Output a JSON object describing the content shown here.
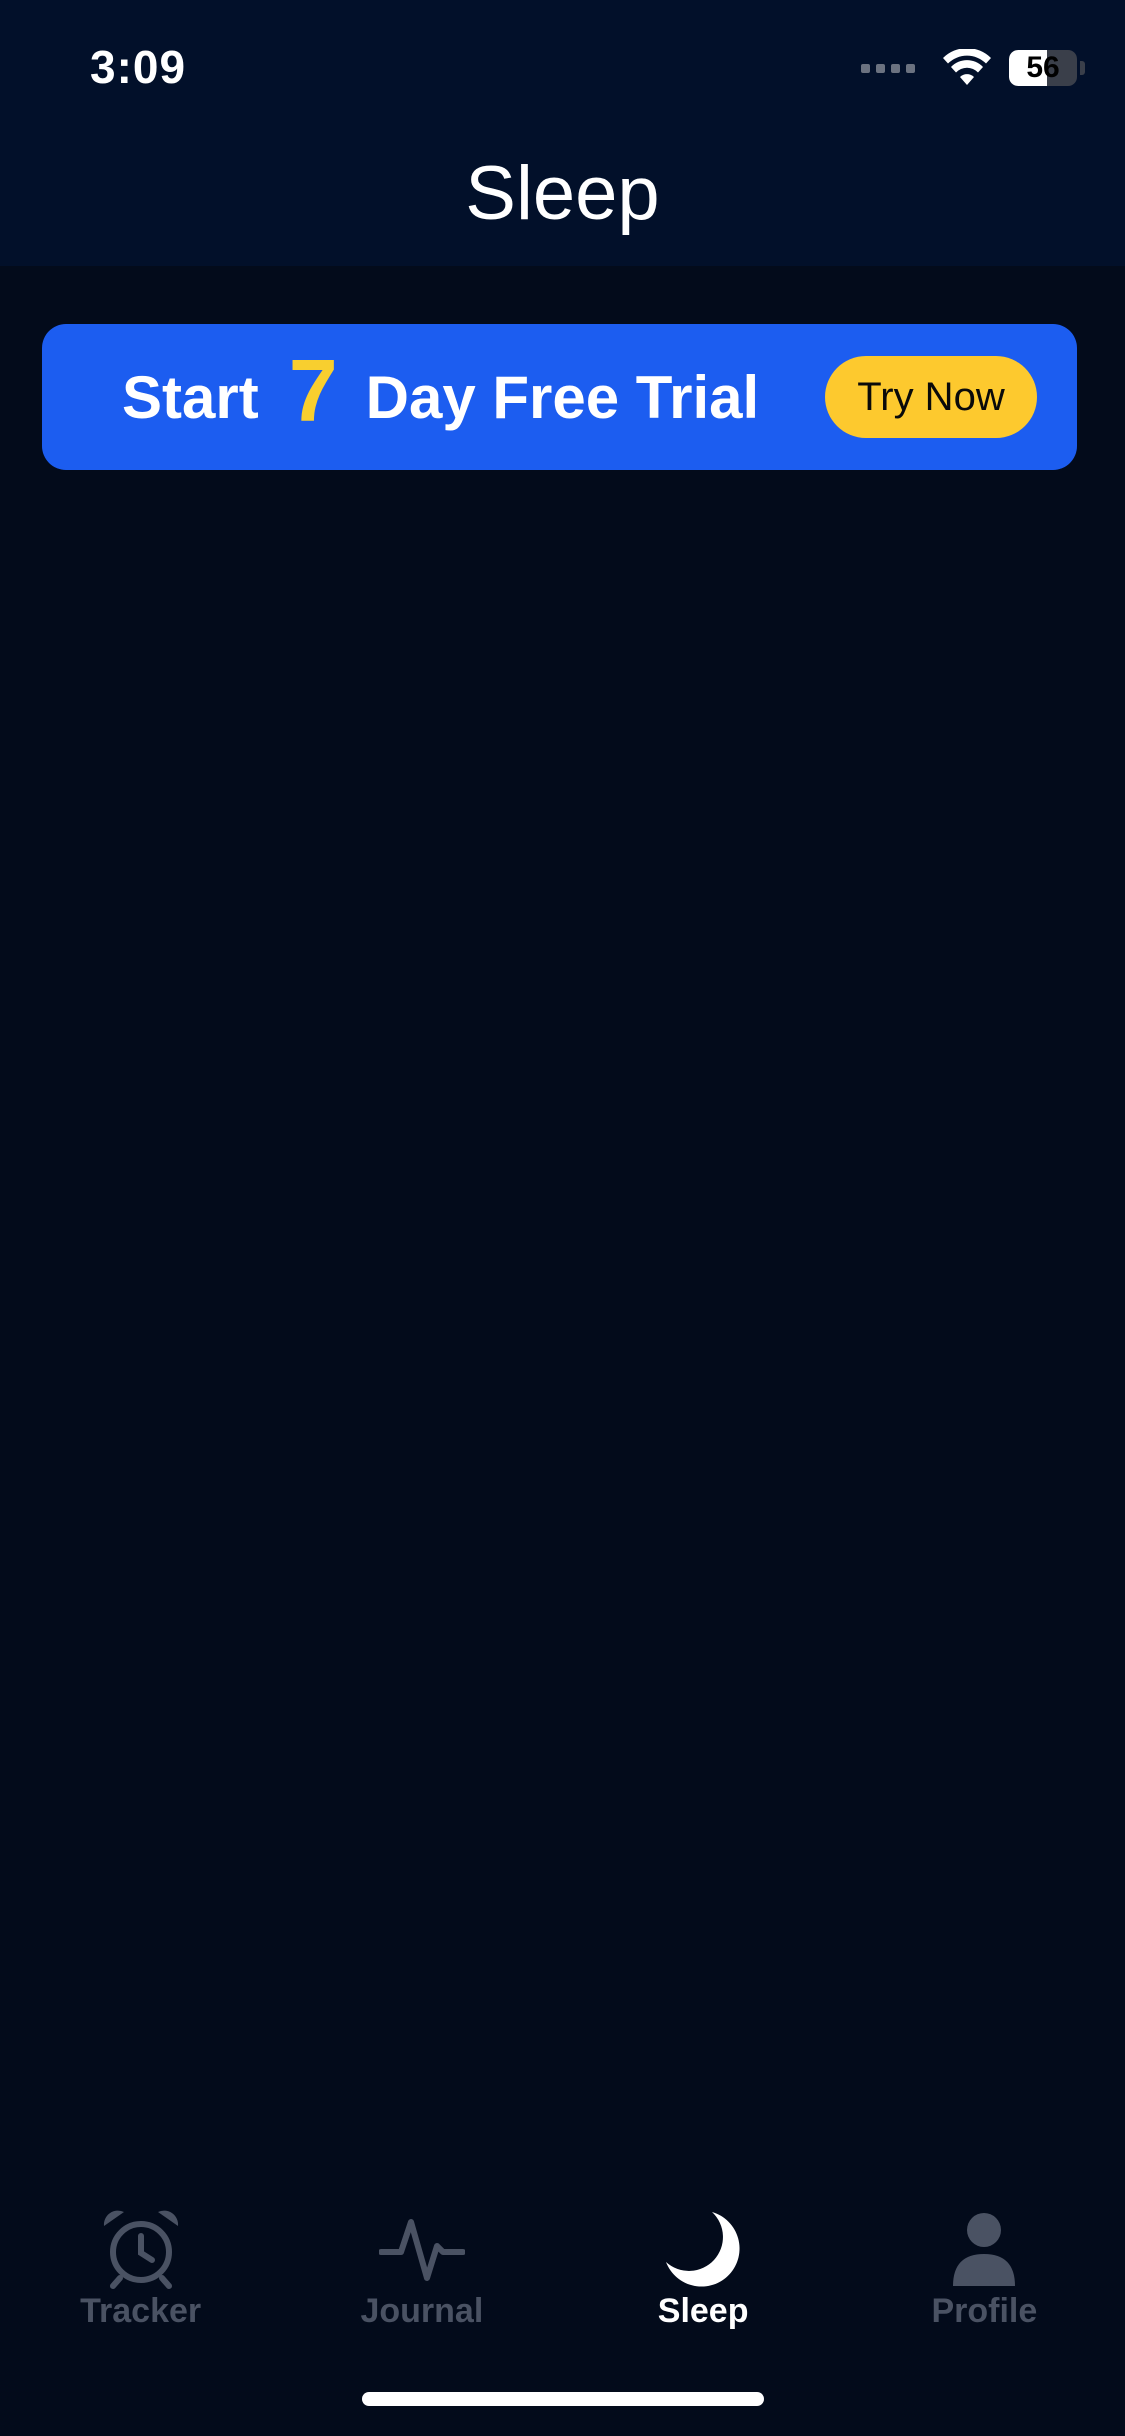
{
  "status_bar": {
    "time": "3:09",
    "battery_level": "56",
    "battery_percent": 56
  },
  "header": {
    "title": "Sleep"
  },
  "promo": {
    "prefix": "Start",
    "number": "7",
    "suffix": "Day Free Trial",
    "button_label": "Try Now",
    "banner_color": "#1c5df0",
    "accent_color": "#f8cf2f",
    "button_color": "#fdc92e"
  },
  "tabs": [
    {
      "label": "Tracker",
      "icon": "alarm-clock-icon",
      "active": false
    },
    {
      "label": "Journal",
      "icon": "pulse-icon",
      "active": false
    },
    {
      "label": "Sleep",
      "icon": "moon-icon",
      "active": true
    },
    {
      "label": "Profile",
      "icon": "person-icon",
      "active": false
    }
  ],
  "colors": {
    "background": "#030b1b",
    "header_background": "#02102a",
    "tab_inactive": "#4a5263",
    "tab_active": "#ffffff"
  }
}
